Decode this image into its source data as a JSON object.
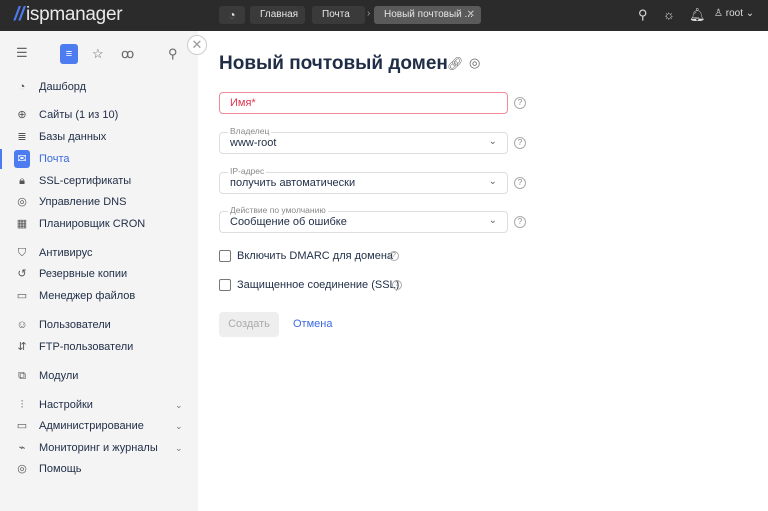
{
  "header": {
    "logo": "ispmanager",
    "breadcrumbs": [
      "Главная",
      "Почта",
      "Новый почтовый ..."
    ],
    "user": "root"
  },
  "sidebar": {
    "items": [
      {
        "label": "Дашборд",
        "icon": "◔"
      },
      {
        "label": "Сайты (1 из 10)",
        "icon": "⊕"
      },
      {
        "label": "Базы данных",
        "icon": "≣"
      },
      {
        "label": "Почта",
        "icon": "✉"
      },
      {
        "label": "SSL-сертификаты",
        "icon": "🔒︎"
      },
      {
        "label": "Управление DNS",
        "icon": "◎"
      },
      {
        "label": "Планировщик CRON",
        "icon": "▦"
      },
      {
        "label": "Антивирус",
        "icon": "⛉"
      },
      {
        "label": "Резервные копии",
        "icon": "↺"
      },
      {
        "label": "Менеджер файлов",
        "icon": "▭"
      },
      {
        "label": "Пользователи",
        "icon": "☺"
      },
      {
        "label": "FTP-пользователи",
        "icon": "⇵"
      },
      {
        "label": "Модули",
        "icon": "⧉"
      },
      {
        "label": "Настройки",
        "icon": "⫶"
      },
      {
        "label": "Администрирование",
        "icon": "▭"
      },
      {
        "label": "Мониторинг и журналы",
        "icon": "⌁"
      },
      {
        "label": "Помощь",
        "icon": "◎"
      }
    ]
  },
  "form": {
    "title": "Новый почтовый домен",
    "name_label": "Имя*",
    "owner_label": "Владелец",
    "owner": "www-root",
    "ip_label": "IP-адрес",
    "ip": "получить автоматически",
    "action_label": "Действие по умолчанию",
    "action": "Сообщение об ошибке",
    "dmarc": "Включить DMARC для домена",
    "ssl": "Защищенное соединение (SSL)",
    "create": "Создать",
    "cancel": "Отмена"
  }
}
